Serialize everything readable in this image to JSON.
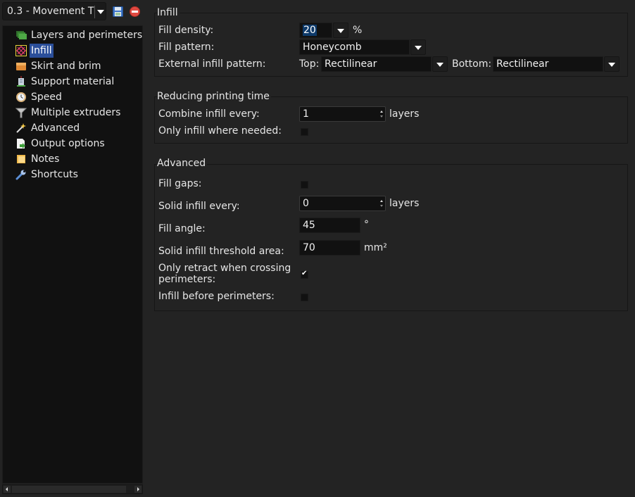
{
  "preset": {
    "selected": "0.3 - Movement T",
    "save_icon": "save-icon",
    "delete_icon": "delete-icon"
  },
  "sidebar": {
    "items": [
      {
        "label": "Layers and perimeters",
        "icon": "layers-icon"
      },
      {
        "label": "Infill",
        "icon": "infill-icon",
        "selected": true
      },
      {
        "label": "Skirt and brim",
        "icon": "box-icon"
      },
      {
        "label": "Support material",
        "icon": "building-icon"
      },
      {
        "label": "Speed",
        "icon": "clock-icon"
      },
      {
        "label": "Multiple extruders",
        "icon": "funnel-icon"
      },
      {
        "label": "Advanced",
        "icon": "wand-icon"
      },
      {
        "label": "Output options",
        "icon": "export-page-icon"
      },
      {
        "label": "Notes",
        "icon": "note-icon"
      },
      {
        "label": "Shortcuts",
        "icon": "wrench-icon"
      }
    ]
  },
  "infill_group": {
    "title": "Infill",
    "fill_density": {
      "label": "Fill density:",
      "value": "20",
      "unit": "%"
    },
    "fill_pattern": {
      "label": "Fill pattern:",
      "value": "Honeycomb"
    },
    "external_pattern": {
      "label": "External infill pattern:",
      "top_label": "Top:",
      "top_value": "Rectilinear",
      "bottom_label": "Bottom:",
      "bottom_value": "Rectilinear"
    }
  },
  "reducing_group": {
    "title": "Reducing printing time",
    "combine_infill": {
      "label": "Combine infill every:",
      "value": "1",
      "unit": "layers"
    },
    "only_infill_needed": {
      "label": "Only infill where needed:",
      "checked": false
    }
  },
  "advanced_group": {
    "title": "Advanced",
    "fill_gaps": {
      "label": "Fill gaps:",
      "checked": false
    },
    "solid_infill_every": {
      "label": "Solid infill every:",
      "value": "0",
      "unit": "layers"
    },
    "fill_angle": {
      "label": "Fill angle:",
      "value": "45",
      "unit": "°"
    },
    "solid_threshold": {
      "label": "Solid infill threshold area:",
      "value": "70",
      "unit": "mm²"
    },
    "only_retract": {
      "label_line1": "Only retract when crossing",
      "label_line2": "perimeters:",
      "checked": true
    },
    "infill_before": {
      "label": "Infill before perimeters:",
      "checked": false
    }
  }
}
